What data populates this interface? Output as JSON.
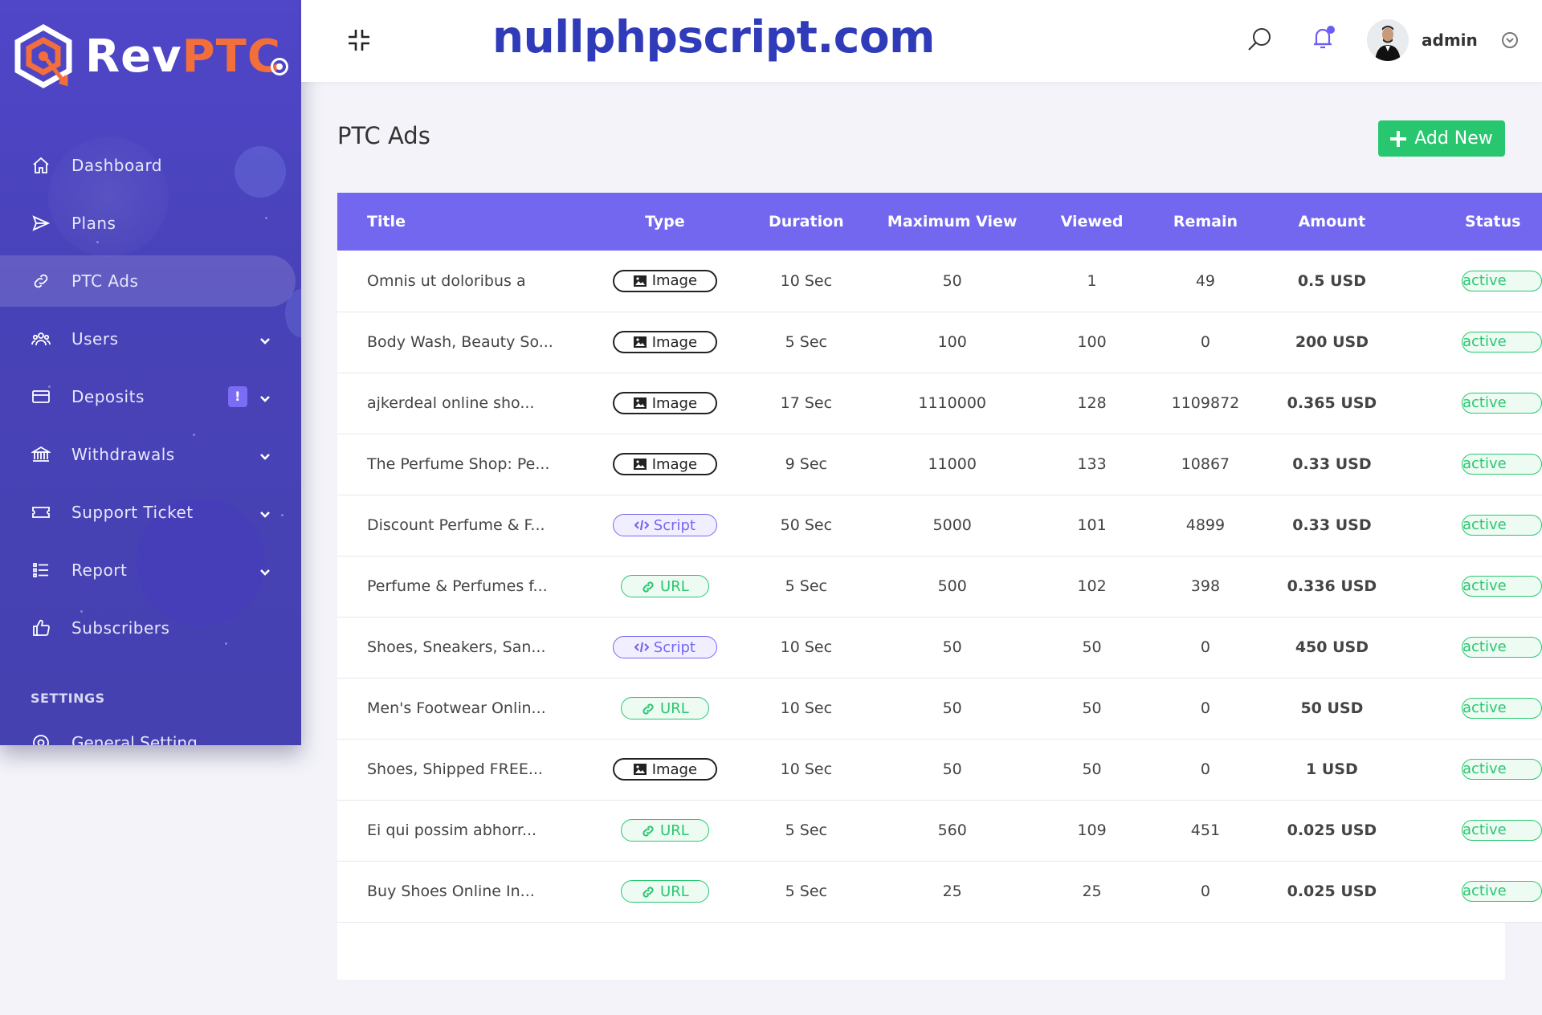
{
  "brand": {
    "name_part1": "Rev",
    "name_part2": "PTC",
    "accent": "#f26e3b"
  },
  "topbar": {
    "watermark": "nullphpscript.com",
    "user_name": "admin",
    "search_icon": "search-icon",
    "bell_icon": "bell-icon"
  },
  "sidebar": {
    "items": [
      {
        "label": "Dashboard",
        "icon": "home-icon"
      },
      {
        "label": "Plans",
        "icon": "send-icon"
      },
      {
        "label": "PTC Ads",
        "icon": "link-icon",
        "active": true
      },
      {
        "label": "Users",
        "icon": "users-icon",
        "expandable": true
      },
      {
        "label": "Deposits",
        "icon": "credit-card-icon",
        "expandable": true,
        "badge": "!"
      },
      {
        "label": "Withdrawals",
        "icon": "bank-icon",
        "expandable": true
      },
      {
        "label": "Support Ticket",
        "icon": "ticket-icon",
        "expandable": true
      },
      {
        "label": "Report",
        "icon": "list-icon",
        "expandable": true
      },
      {
        "label": "Subscribers",
        "icon": "thumbs-up-icon"
      }
    ],
    "settings_heading": "SETTINGS",
    "general_setting": "General Setting"
  },
  "page": {
    "title": "PTC Ads",
    "add_button": "Add New"
  },
  "table": {
    "headers": [
      "Title",
      "Type",
      "Duration",
      "Maximum View",
      "Viewed",
      "Remain",
      "Amount",
      "Status"
    ],
    "rows": [
      {
        "title": "Omnis ut doloribus a",
        "type": "Image",
        "duration": "10 Sec",
        "max": "50",
        "viewed": "1",
        "remain": "49",
        "amount": "0.5 USD",
        "status": "active"
      },
      {
        "title": "Body Wash, Beauty So...",
        "type": "Image",
        "duration": "5 Sec",
        "max": "100",
        "viewed": "100",
        "remain": "0",
        "amount": "200 USD",
        "status": "active"
      },
      {
        "title": "ajkerdeal online sho...",
        "type": "Image",
        "duration": "17 Sec",
        "max": "1110000",
        "viewed": "128",
        "remain": "1109872",
        "amount": "0.365 USD",
        "status": "active"
      },
      {
        "title": "The Perfume Shop: Pe...",
        "type": "Image",
        "duration": "9 Sec",
        "max": "11000",
        "viewed": "133",
        "remain": "10867",
        "amount": "0.33 USD",
        "status": "active"
      },
      {
        "title": "Discount Perfume & F...",
        "type": "Script",
        "duration": "50 Sec",
        "max": "5000",
        "viewed": "101",
        "remain": "4899",
        "amount": "0.33 USD",
        "status": "active"
      },
      {
        "title": "Perfume & Perfumes f...",
        "type": "URL",
        "duration": "5 Sec",
        "max": "500",
        "viewed": "102",
        "remain": "398",
        "amount": "0.336 USD",
        "status": "active"
      },
      {
        "title": "Shoes, Sneakers, San...",
        "type": "Script",
        "duration": "10 Sec",
        "max": "50",
        "viewed": "50",
        "remain": "0",
        "amount": "450 USD",
        "status": "active"
      },
      {
        "title": "Men's Footwear Onlin...",
        "type": "URL",
        "duration": "10 Sec",
        "max": "50",
        "viewed": "50",
        "remain": "0",
        "amount": "50 USD",
        "status": "active"
      },
      {
        "title": "Shoes, Shipped FREE...",
        "type": "Image",
        "duration": "10 Sec",
        "max": "50",
        "viewed": "50",
        "remain": "0",
        "amount": "1 USD",
        "status": "active"
      },
      {
        "title": "Ei qui possim abhorr...",
        "type": "URL",
        "duration": "5 Sec",
        "max": "560",
        "viewed": "109",
        "remain": "451",
        "amount": "0.025 USD",
        "status": "active"
      },
      {
        "title": "Buy Shoes Online In...",
        "type": "URL",
        "duration": "5 Sec",
        "max": "25",
        "viewed": "25",
        "remain": "0",
        "amount": "0.025 USD",
        "status": "active"
      }
    ]
  },
  "colors": {
    "sidebar": "#4f46c8",
    "table_header": "#7367f0",
    "success": "#28c76f",
    "brand_accent": "#f26e3b",
    "watermark": "#2f3bb8"
  }
}
